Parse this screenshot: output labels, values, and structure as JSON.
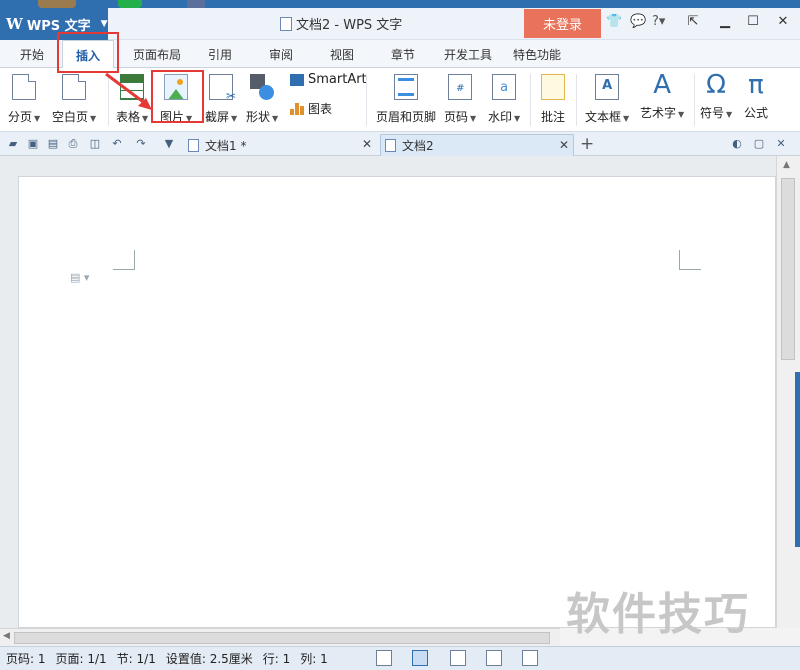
{
  "app": {
    "name": "WPS 文字",
    "window_title": "文档2 - WPS 文字",
    "login_button": "未登录",
    "help_label": "?"
  },
  "menu": {
    "tabs": [
      "开始",
      "插入",
      "页面布局",
      "引用",
      "审阅",
      "视图",
      "章节",
      "开发工具",
      "特色功能"
    ],
    "active_tab": "插入"
  },
  "ribbon": {
    "page_break": "分页",
    "blank_page": "空白页",
    "table": "表格",
    "picture": "图片",
    "screenshot": "截屏",
    "shapes": "形状",
    "smartart": "SmartArt",
    "chart": "图表",
    "header_footer": "页眉和页脚",
    "page_number": "页码",
    "watermark": "水印",
    "comment": "批注",
    "textbox": "文本框",
    "wordart": "艺术字",
    "symbol": "符号",
    "equation": "公式",
    "symbol_glyph": "Ω",
    "equation_glyph": "π",
    "wordart_glyph": "A"
  },
  "doc_tabs": [
    {
      "label": "文档1 *",
      "active": false
    },
    {
      "label": "文档2",
      "active": true
    }
  ],
  "watermark_text": "软件技巧",
  "status": {
    "page_code": "页码: 1",
    "pages": "页面: 1/1",
    "section": "节: 1/1",
    "setting": "设置值: 2.5厘米",
    "row": "行: 1",
    "col": "列: 1"
  },
  "colors": {
    "accent": "#2f6fb0",
    "login": "#e8735a",
    "highlight": "#e53935"
  }
}
